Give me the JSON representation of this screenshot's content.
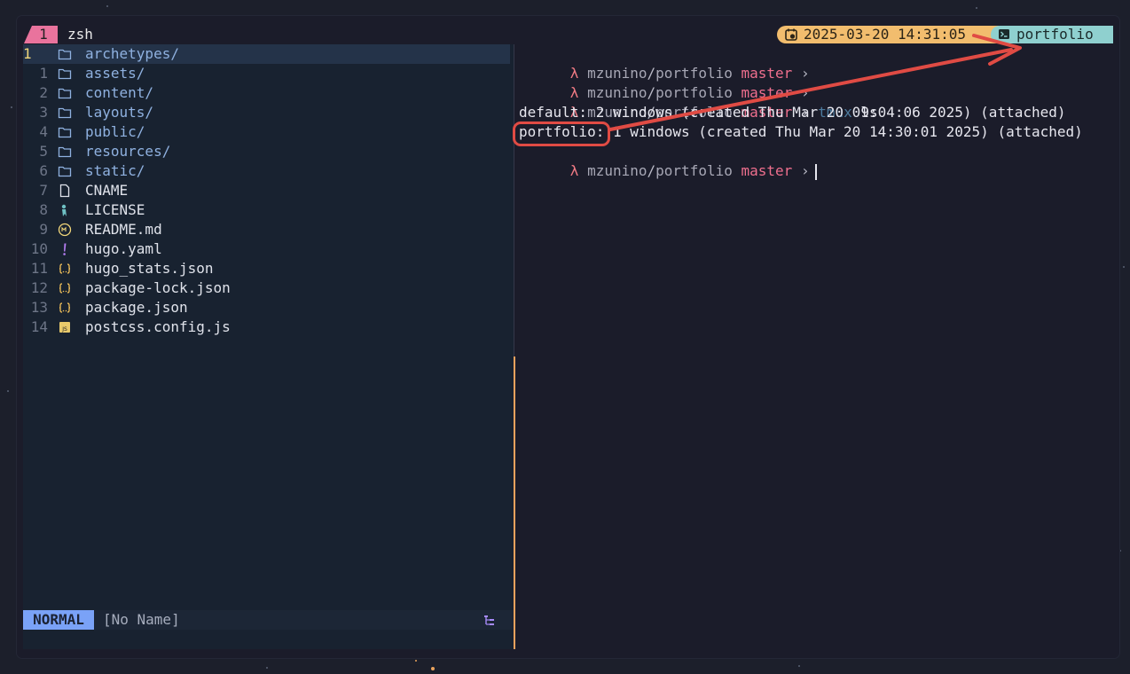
{
  "tmux": {
    "window_index": "1",
    "window_name": "zsh",
    "clock": "2025-03-20 14:31:05",
    "session": "portfolio"
  },
  "nvim": {
    "files": [
      {
        "num": "1",
        "name": "archetypes/",
        "type": "folder",
        "current": true
      },
      {
        "num": "1",
        "name": "assets/",
        "type": "folder"
      },
      {
        "num": "2",
        "name": "content/",
        "type": "folder"
      },
      {
        "num": "3",
        "name": "layouts/",
        "type": "folder"
      },
      {
        "num": "4",
        "name": "public/",
        "type": "folder"
      },
      {
        "num": "5",
        "name": "resources/",
        "type": "folder"
      },
      {
        "num": "6",
        "name": "static/",
        "type": "folder"
      },
      {
        "num": "7",
        "name": "CNAME",
        "type": "file"
      },
      {
        "num": "8",
        "name": "LICENSE",
        "type": "license"
      },
      {
        "num": "9",
        "name": "README.md",
        "type": "markdown"
      },
      {
        "num": "10",
        "name": "hugo.yaml",
        "type": "yaml"
      },
      {
        "num": "11",
        "name": "hugo_stats.json",
        "type": "json"
      },
      {
        "num": "12",
        "name": "package-lock.json",
        "type": "json"
      },
      {
        "num": "13",
        "name": "package.json",
        "type": "json"
      },
      {
        "num": "14",
        "name": "postcss.config.js",
        "type": "js"
      }
    ],
    "mode": "NORMAL",
    "buffer": "[No Name]"
  },
  "terminal": {
    "prompt": {
      "symbol": "λ",
      "user": "mzunino",
      "slash": "/",
      "repo": "portfolio",
      "branch": "master",
      "arrow": "›"
    },
    "command": {
      "dim": "tmux",
      "rest": " ls"
    },
    "output": [
      "default: 2 windows (created Thu Mar 20 09:04:06 2025) (attached)",
      "portfolio: 1 windows (created Thu Mar 20 14:30:01 2025) (attached)"
    ]
  },
  "colors": {
    "accent_pink": "#e9739d",
    "clock_bg": "#f2bd6e",
    "session_bg": "#8fd0cf",
    "mode_bg": "#7aa2f7",
    "annotation": "#e04b44"
  }
}
